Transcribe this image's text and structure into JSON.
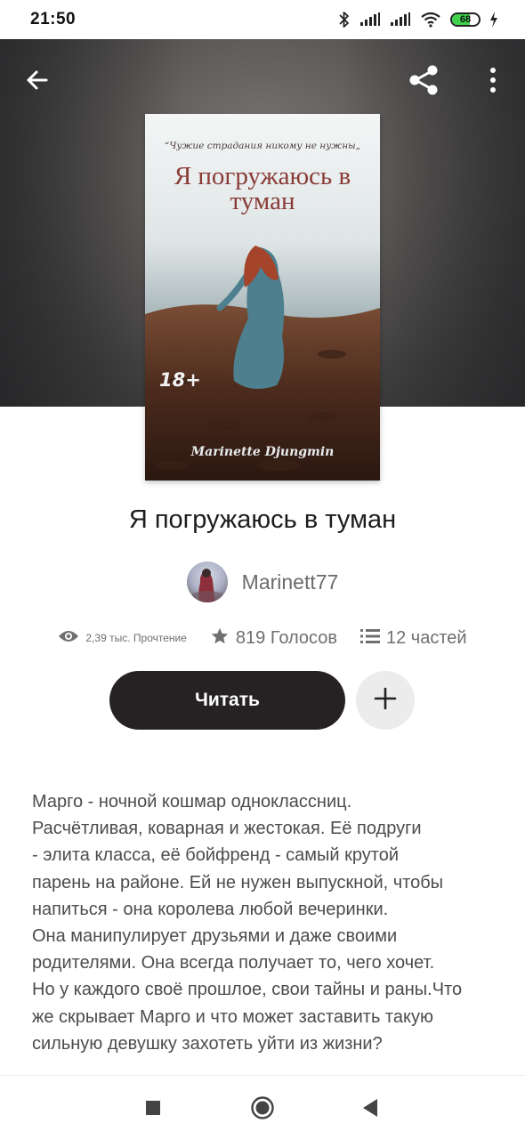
{
  "status_bar": {
    "time": "21:50",
    "battery": "68",
    "battery_level": 0.68,
    "icons": [
      "bluetooth-icon",
      "signal-icon",
      "signal-icon",
      "wifi-icon",
      "battery-icon",
      "charging-icon"
    ]
  },
  "header": {
    "icons": [
      "arrow-back-icon",
      "share-icon",
      "more-vertical-icon"
    ]
  },
  "cover": {
    "quote": "“Чужие страдания никому не нужны„",
    "title": "Я погружаюсь в туман",
    "age_rating": "18+",
    "author": "Marinette Djungmin"
  },
  "book": {
    "title": "Я погружаюсь в туман",
    "author": "Marinett77"
  },
  "stats": {
    "reads": "2,39 тыс. Прочтение",
    "votes": "819 Голосов",
    "parts": "12 частей",
    "icons": [
      "eye-icon",
      "star-icon",
      "list-icon"
    ]
  },
  "actions": {
    "read_label": "Читать",
    "add_icon": "plus-icon"
  },
  "description": "Марго - ночной кошмар одноклассниц.\nРасчётливая, коварная и жестокая. Её подруги\n- элита класса, её бойфренд - самый крутой\nпарень на районе. Ей не нужен выпускной, чтобы\nнапиться - она королева любой вечеринки.\nОна манипулирует друзьями и даже своими\nродителями. Она всегда получает то, чего хочет.\nНо у каждого своё прошлое, свои тайны и раны.Что\nже скрывает Марго и что может заставить такую\nсильную девушку захотеть уйти из жизни?",
  "nav": {
    "icons": [
      "recents-icon",
      "home-icon",
      "back-icon"
    ]
  },
  "colors": {
    "primary_button": "#262224",
    "secondary_button": "#ececed",
    "cover_title": "#8a3b36",
    "battery": "#3fd24a"
  }
}
